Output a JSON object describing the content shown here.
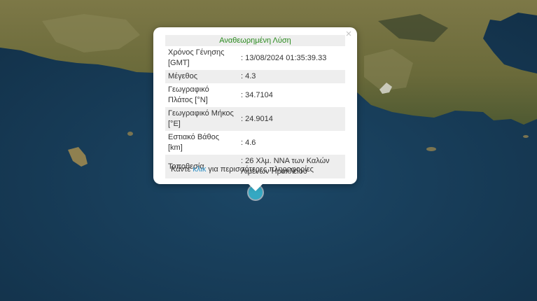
{
  "popup": {
    "title": "Αναθεωρημένη Λύση",
    "close_symbol": "×",
    "rows": [
      {
        "label": "Χρόνος Γένησης [GMT]",
        "value": ": 13/08/2024 01:35:39.33"
      },
      {
        "label": "Μέγεθος",
        "value": ": 4.3"
      },
      {
        "label": "Γεωγραφικό Πλάτος [°N]",
        "value": ": 34.7104"
      },
      {
        "label": "Γεωγραφικό Μήκος [°E]",
        "value": ": 24.9014"
      },
      {
        "label": "Εστιακό Βάθος [km]",
        "value": ": 4.6"
      },
      {
        "label": "Τοποθεσία",
        "value": ": 26 Χλμ. ΝΝΑ των Καλών Λιμένων Ηρακλείου"
      }
    ],
    "more_prefix": "Κάντε ",
    "more_link": "κλικ",
    "more_suffix": " για περισσότερες πληροφορίες"
  },
  "map": {
    "sea_color": "#163a57",
    "land_color": "#6e6a3e",
    "marker_color": "#35a8c2",
    "marker_icon": "earthquake-epicenter-icon"
  }
}
